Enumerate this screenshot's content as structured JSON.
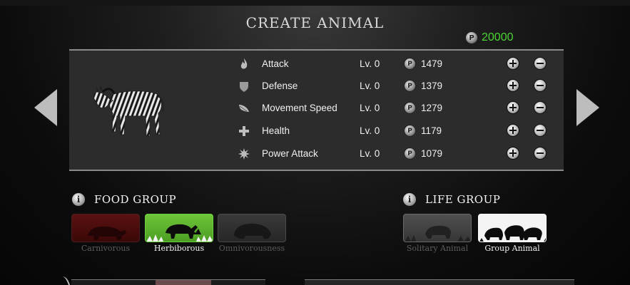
{
  "header": {
    "title": "CREATE ANIMAL"
  },
  "points": {
    "coin_symbol": "P",
    "value": "20000",
    "color": "#4bd633"
  },
  "animal": {
    "name": "zebra"
  },
  "stats": [
    {
      "name": "Attack",
      "level": "Lv. 0",
      "cost": "1479",
      "icon": "attack-icon"
    },
    {
      "name": "Defense",
      "level": "Lv. 0",
      "cost": "1379",
      "icon": "shield-icon"
    },
    {
      "name": "Movement Speed",
      "level": "Lv. 0",
      "cost": "1279",
      "icon": "speed-icon"
    },
    {
      "name": "Health",
      "level": "Lv. 0",
      "cost": "1179",
      "icon": "plus-health-icon"
    },
    {
      "name": "Power Attack",
      "level": "Lv. 0",
      "cost": "1079",
      "icon": "burst-icon"
    }
  ],
  "food_group": {
    "title": "FOOD GROUP",
    "info_symbol": "i",
    "selected": "Herbiborous",
    "options": [
      {
        "label": "Carnivorous"
      },
      {
        "label": "Herbiborous"
      },
      {
        "label": "Omnivorousness"
      }
    ]
  },
  "life_group": {
    "title": "LIFE GROUP",
    "info_symbol": "i",
    "selected": "Group Animal",
    "options": [
      {
        "label": "Solitary Animal"
      },
      {
        "label": "Group Animal"
      }
    ]
  }
}
